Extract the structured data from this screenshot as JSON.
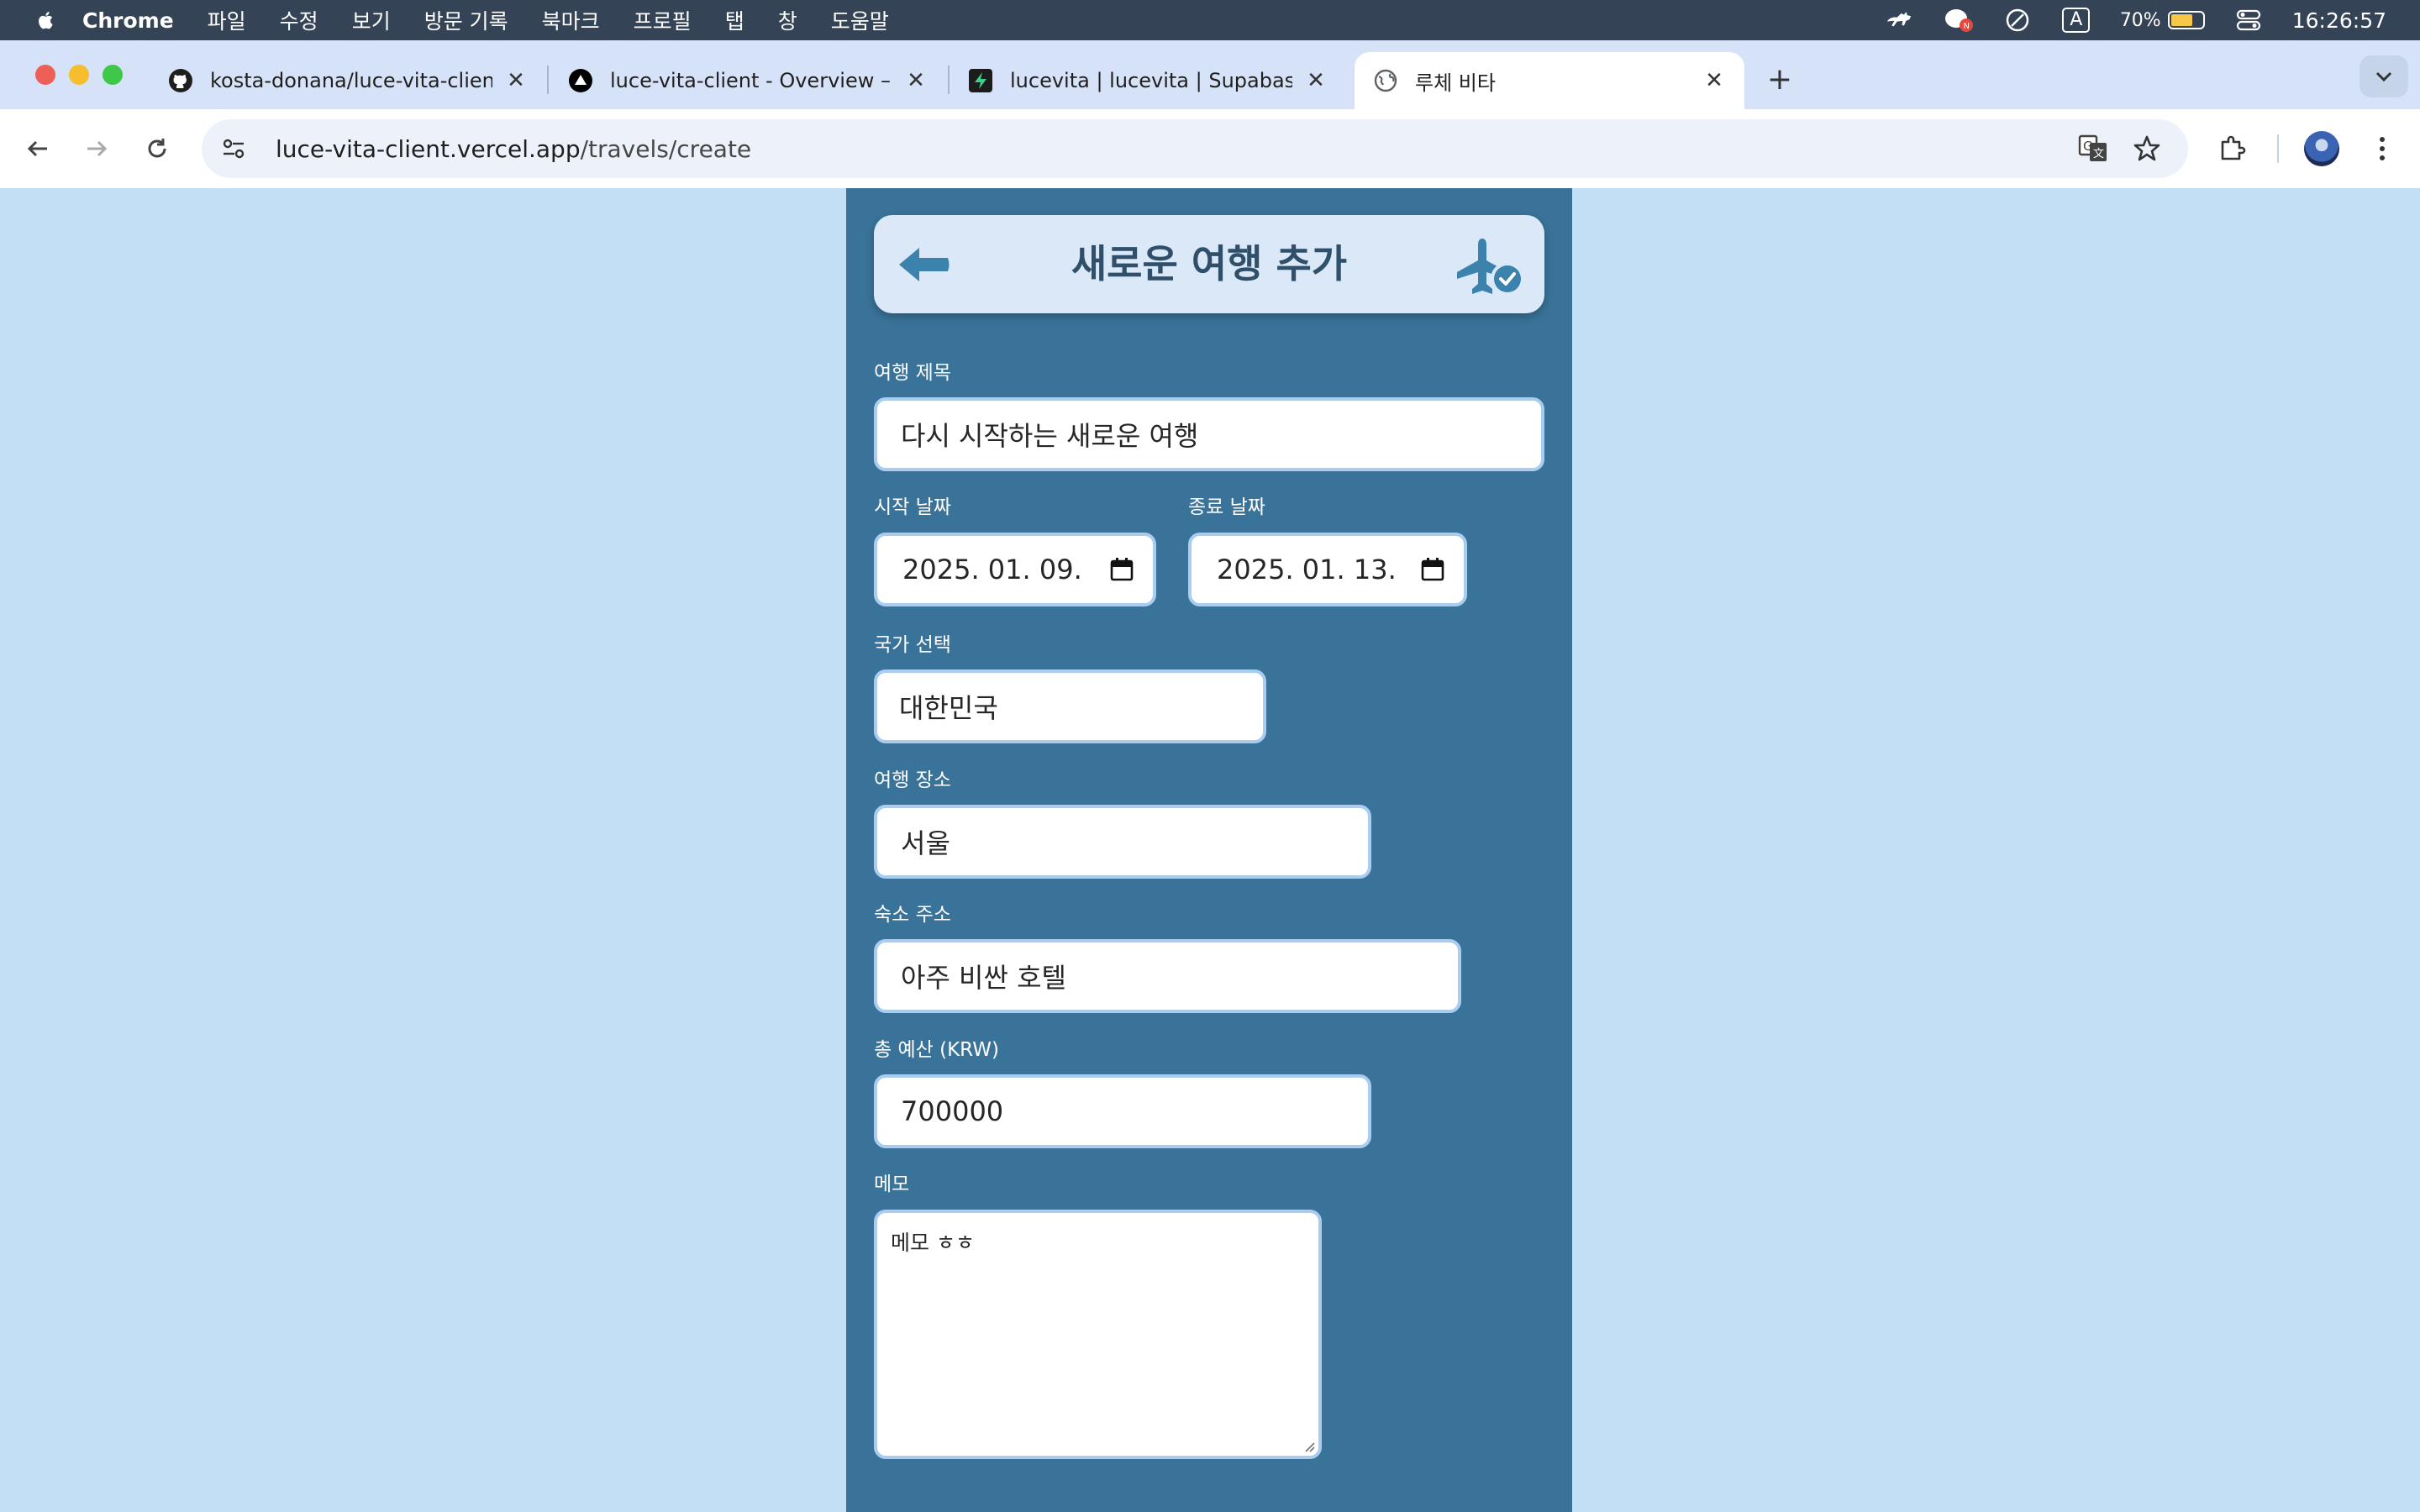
{
  "menubar": {
    "app": "Chrome",
    "items": [
      "파일",
      "수정",
      "보기",
      "방문 기록",
      "북마크",
      "프로필",
      "탭",
      "창",
      "도움말"
    ],
    "battery": "70%",
    "input_indicator": "A",
    "time": "16:26:57"
  },
  "tabs": [
    {
      "title": "kosta-donana/luce-vita-client",
      "favicon": "github-icon",
      "active": false
    },
    {
      "title": "luce-vita-client - Overview – ",
      "favicon": "vercel-icon",
      "active": false
    },
    {
      "title": "lucevita | lucevita | Supabase",
      "favicon": "supabase-icon",
      "active": false
    },
    {
      "title": "루체 비타",
      "favicon": "globe-icon",
      "active": true
    }
  ],
  "toolbar": {
    "url_host": "luce-vita-client.vercel.app",
    "url_path": "/travels/create"
  },
  "form": {
    "header_title": "새로운 여행 추가",
    "title_label": "여행 제목",
    "title_value": "다시 시작하는 새로운 여행",
    "start_label": "시작 날짜",
    "start_value": "2025. 01. 09.",
    "end_label": "종료 날짜",
    "end_value": "2025. 01. 13.",
    "country_label": "국가 선택",
    "country_value": "대한민국",
    "place_label": "여행 장소",
    "place_value": "서울",
    "lodging_label": "숙소 주소",
    "lodging_value": "아주 비싼 호텔",
    "budget_label": "총 예산 (KRW)",
    "budget_value": "700000",
    "memo_label": "메모",
    "memo_value": "메모 ㅎㅎ"
  },
  "colors": {
    "page_bg": "#c3dff5",
    "panel_bg": "#397399",
    "header_card": "#dbe8f7",
    "accent_icon": "#3b82ad",
    "field_border": "#a9cdf0"
  }
}
